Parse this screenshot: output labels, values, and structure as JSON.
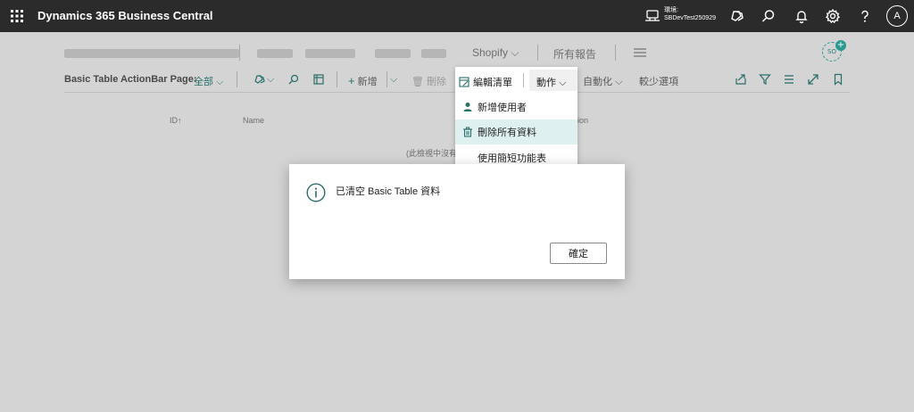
{
  "app": {
    "title": "Dynamics 365 Business Central",
    "env_label": "環境:",
    "env_name": "SBDevTest250929",
    "avatar_initial": "A"
  },
  "nav": {
    "shopify": "Shopify",
    "all_reports": "所有報告",
    "so_badge": "SO",
    "so_plus": "+"
  },
  "actionbar": {
    "page_label": "Basic Table ActionBar Page:",
    "filter_all": "全部",
    "new": "新增",
    "delete": "刪除",
    "automate": "自動化",
    "fewer_options": "較少選項"
  },
  "table": {
    "col_id": "ID↑",
    "col_name": "Name",
    "col_description_fragment": "ion",
    "empty_fragment": "(此檢視中沒有"
  },
  "menu": {
    "edit_list": "編輯清單",
    "actions": "動作",
    "items": [
      {
        "label": "新增使用者",
        "icon": "user-icon"
      },
      {
        "label": "刪除所有資料",
        "icon": "trash-icon",
        "selected": true
      },
      {
        "label": "使用簡短功能表",
        "icon": ""
      }
    ]
  },
  "dialog": {
    "message": "已清空 Basic Table 資料",
    "ok_label": "確定"
  },
  "colors": {
    "topbar": "#2b2b2b",
    "accent": "#2a9a8f",
    "menu_selected": "#dff0f1"
  }
}
